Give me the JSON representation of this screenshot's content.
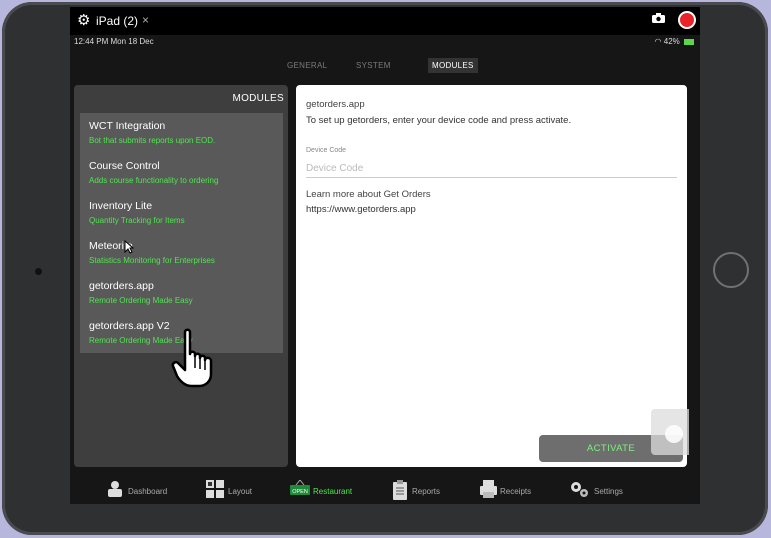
{
  "simulator": {
    "title": "iPad (2)",
    "close": "×"
  },
  "status_bar": {
    "time": "12:44 PM  Mon 18 Dec",
    "battery": "42%"
  },
  "tabs": [
    {
      "label": "GENERAL",
      "active": false
    },
    {
      "label": "SYSTEM",
      "active": false
    },
    {
      "label": "MODULES",
      "active": true
    }
  ],
  "modules": {
    "header": "MODULES",
    "items": [
      {
        "name": "WCT Integration",
        "desc": "Bot that submits reports upon EOD."
      },
      {
        "name": "Course Control",
        "desc": "Adds course functionality to ordering"
      },
      {
        "name": "Inventory Lite",
        "desc": "Quantity Tracking for Items"
      },
      {
        "name": "Meteorite",
        "desc": "Statistics Monitoring for Enterprises"
      },
      {
        "name": "getorders.app",
        "desc": "Remote Ordering Made Easy"
      },
      {
        "name": "getorders.app V2",
        "desc": "Remote Ordering Made Easy"
      }
    ]
  },
  "detail": {
    "title": "getorders.app",
    "description": "To set up getorders, enter your device code and press activate.",
    "field_label": "Device Code",
    "field_placeholder": "Device Code",
    "field_value": "",
    "learn_more": "Learn more about Get Orders",
    "link": "https://www.getorders.app",
    "activate_label": "ACTIVATE"
  },
  "bottom_nav": [
    {
      "label": "Dashboard",
      "icon": "dashboard-icon"
    },
    {
      "label": "Layout",
      "icon": "layout-icon"
    },
    {
      "label": "Restaurant",
      "icon": "open-sign-icon",
      "badge": "OPEN",
      "active": true
    },
    {
      "label": "Reports",
      "icon": "clipboard-icon"
    },
    {
      "label": "Receipts",
      "icon": "receipt-printer-icon"
    },
    {
      "label": "Settings",
      "icon": "gears-icon"
    }
  ],
  "colors": {
    "accent_green": "#4ee64e",
    "record_red": "#e8232a"
  }
}
